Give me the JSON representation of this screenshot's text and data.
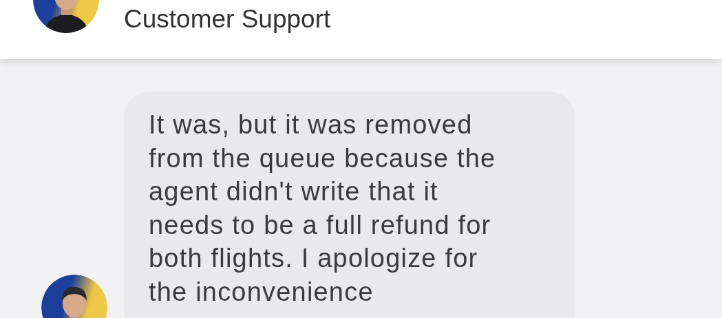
{
  "header": {
    "title": "Customer Support"
  },
  "messages": [
    {
      "text": "It was, but it was removed from the queue because the agent didn't write that it needs to be a full refund for both flights. I apologize for the inconvenience"
    }
  ]
}
